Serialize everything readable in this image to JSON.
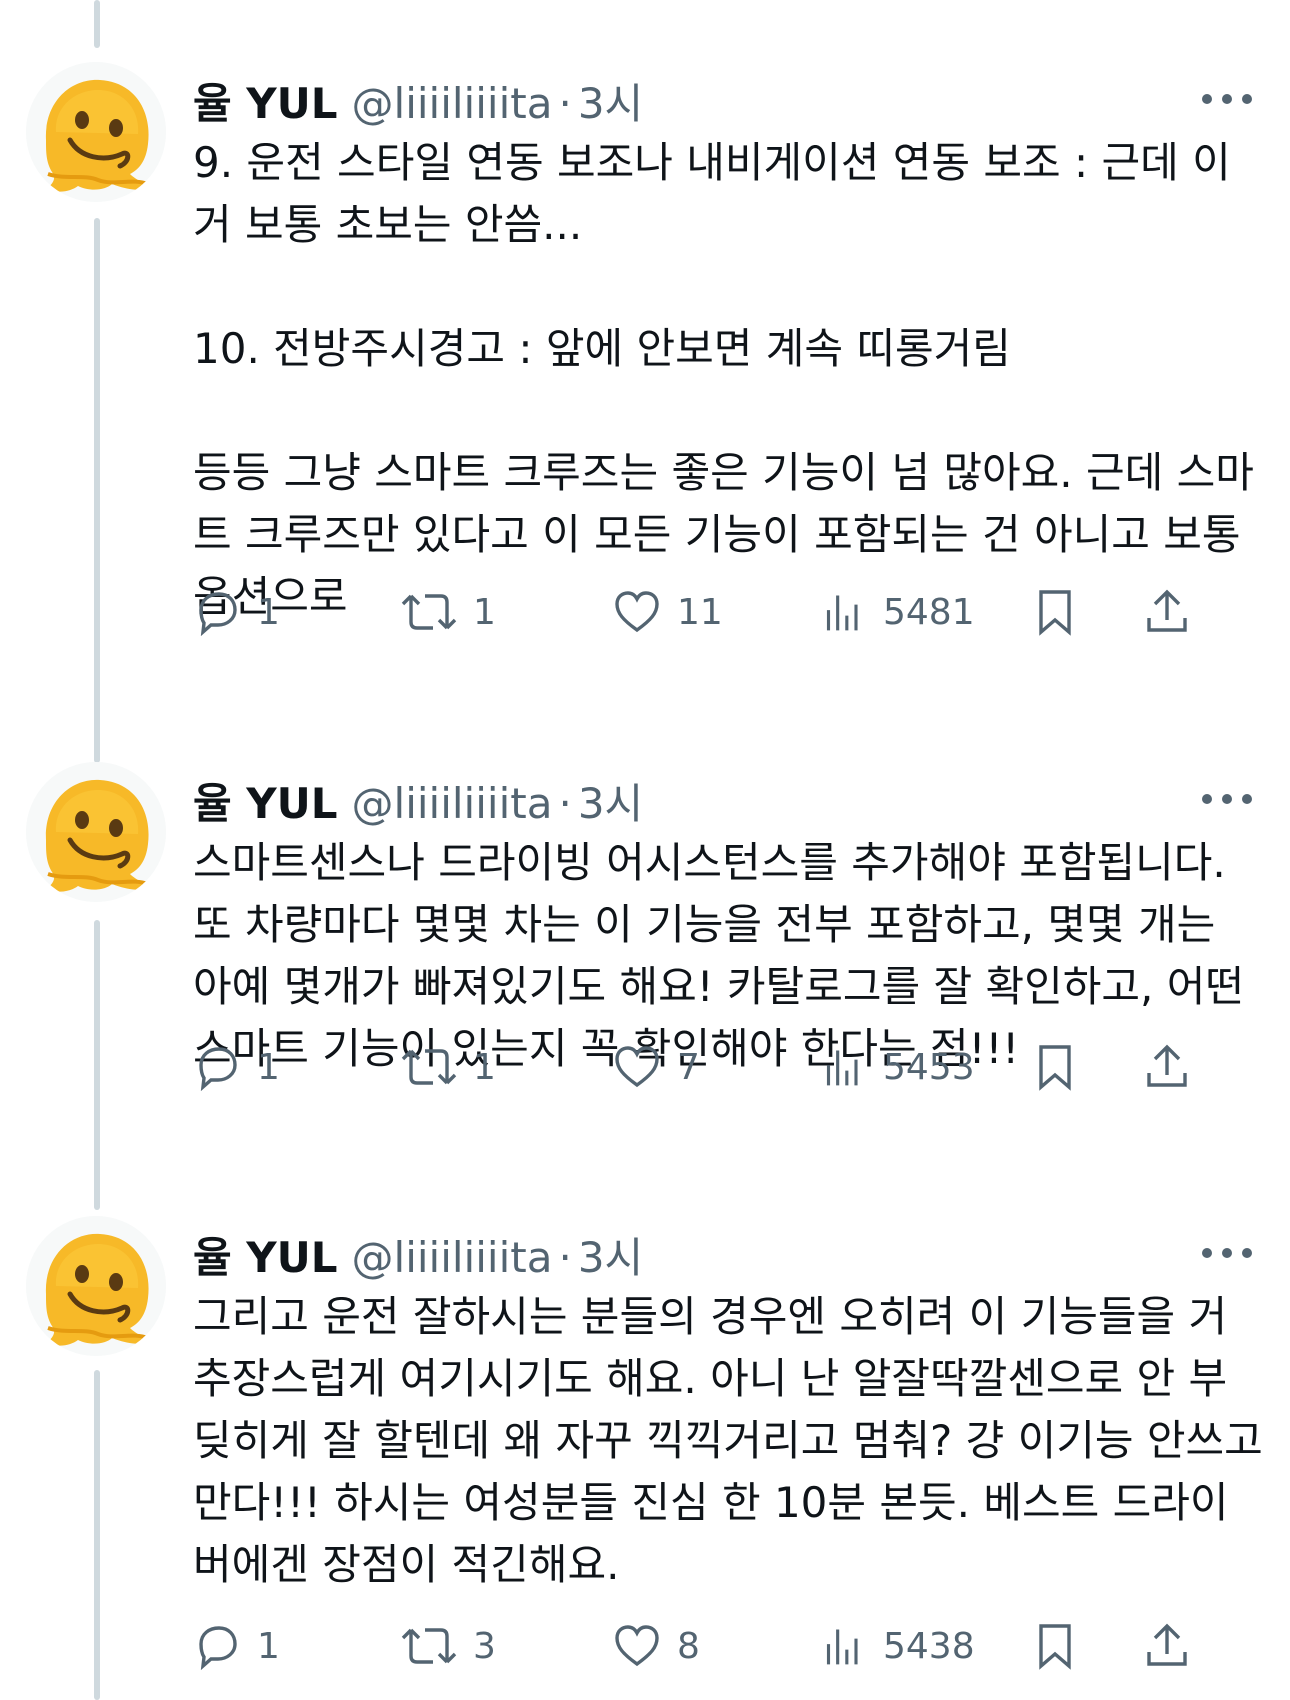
{
  "tweets": [
    {
      "display_name": "율 YUL",
      "handle": "@liiiiliiiita",
      "separator": "·",
      "time": "3시",
      "text": "9. 운전 스타일 연동 보조나 내비게이션 연동 보조 : 근데 이거 보통 초보는 안씀...\n\n10. 전방주시경고 : 앞에 안보면 계속 띠롱거림\n\n등등 그냥 스마트 크루즈는 좋은 기능이 넘 많아요. 근데 스마트 크루즈만 있다고 이 모든 기능이 포함되는 건 아니고 보통 옵션으로",
      "replies": "1",
      "retweets": "1",
      "likes": "11",
      "views": "5481"
    },
    {
      "display_name": "율 YUL",
      "handle": "@liiiiliiiita",
      "separator": "·",
      "time": "3시",
      "text": "스마트센스나 드라이빙 어시스턴스를 추가해야 포함됩니다. 또 차량마다 몇몇 차는 이 기능을 전부 포함하고, 몇몇 개는 아예 몇개가 빠져있기도 해요! 카탈로그를 잘 확인하고, 어떤 스마트 기능이 있는지 꼭 확인해야 한다는 점!!!",
      "replies": "1",
      "retweets": "1",
      "likes": "7",
      "views": "5453"
    },
    {
      "display_name": "율 YUL",
      "handle": "@liiiiliiiita",
      "separator": "·",
      "time": "3시",
      "text": "그리고 운전 잘하시는 분들의 경우엔 오히려 이 기능들을 거추장스럽게 여기시기도 해요. 아니 난 알잘딱깔센으로 안 부딪히게 잘 할텐데 왜 자꾸 끽끽거리고 멈춰? 걍 이기능 안쓰고 만다!!! 하시는 여성분들 진심 한 10분 본듯. 베스트 드라이버에겐 장점이 적긴해요.",
      "replies": "1",
      "retweets": "3",
      "likes": "8",
      "views": "5438"
    }
  ],
  "icons": {
    "avatar": "melting-face-emoji",
    "more": "more-horizontal-icon",
    "reply": "reply-icon",
    "retweet": "retweet-icon",
    "like": "heart-icon",
    "views": "views-chart-icon",
    "bookmark": "bookmark-icon",
    "share": "share-icon"
  },
  "colors": {
    "text": "#0f1419",
    "secondary": "#536471",
    "thread_line": "#cfd9de",
    "avatar_face": "#f7b928"
  }
}
